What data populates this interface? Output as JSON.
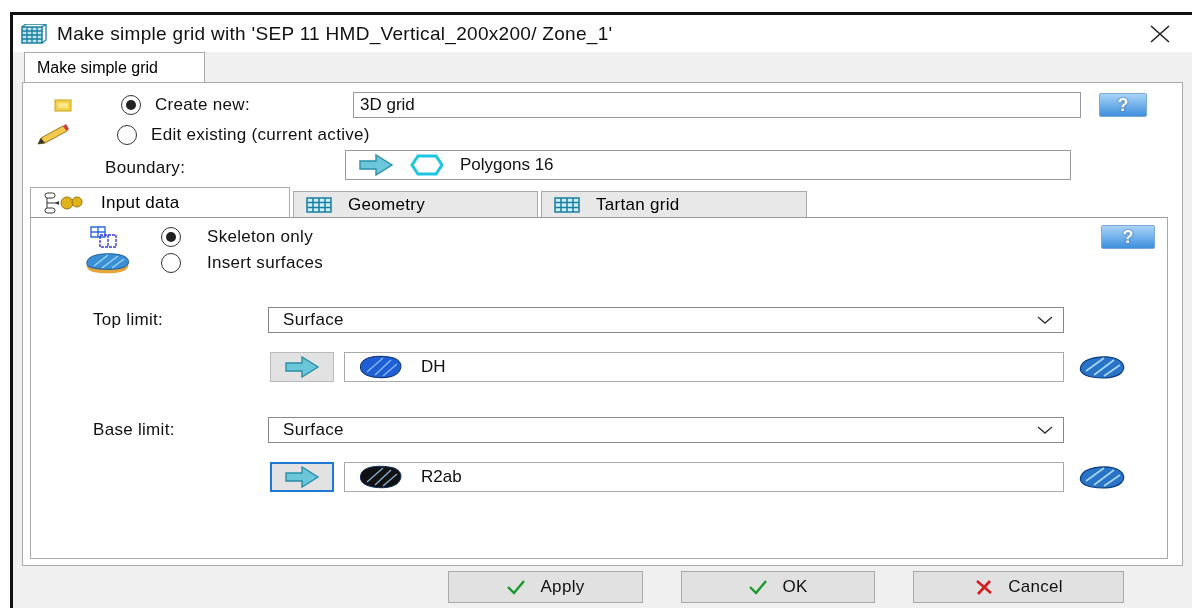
{
  "window": {
    "title": "Make simple grid with 'SEP 11 HMD_Vertical_200x200/ Zone_1'"
  },
  "tabs": [
    {
      "label": "Make simple grid",
      "selected": true
    }
  ],
  "mode_options": [
    {
      "label": "Create new:",
      "selected": true,
      "value": "3D grid"
    },
    {
      "label": "Edit existing (current active)",
      "selected": false
    }
  ],
  "help_buttons": [
    {
      "label": "?"
    },
    {
      "label": "?"
    }
  ],
  "boundary": {
    "label": "Boundary:",
    "value": "Polygons 16"
  },
  "inner_tabs": [
    {
      "label": "Input data",
      "selected": true
    },
    {
      "label": "Geometry",
      "selected": false
    },
    {
      "label": "Tartan grid",
      "selected": false
    }
  ],
  "input_options": [
    {
      "label": "Skeleton only",
      "selected": true
    },
    {
      "label": "Insert surfaces",
      "selected": false
    }
  ],
  "limits": [
    {
      "label": "Top limit:",
      "type": "Surface",
      "value": "DH",
      "color": "#1f5fd6",
      "focused": false
    },
    {
      "label": "Base limit:",
      "type": "Surface",
      "value": "R2ab",
      "color": "#111111",
      "focused": true
    }
  ],
  "buttons": [
    {
      "label": "Apply",
      "kind": "apply"
    },
    {
      "label": "OK",
      "kind": "ok"
    },
    {
      "label": "Cancel",
      "kind": "cancel"
    }
  ]
}
